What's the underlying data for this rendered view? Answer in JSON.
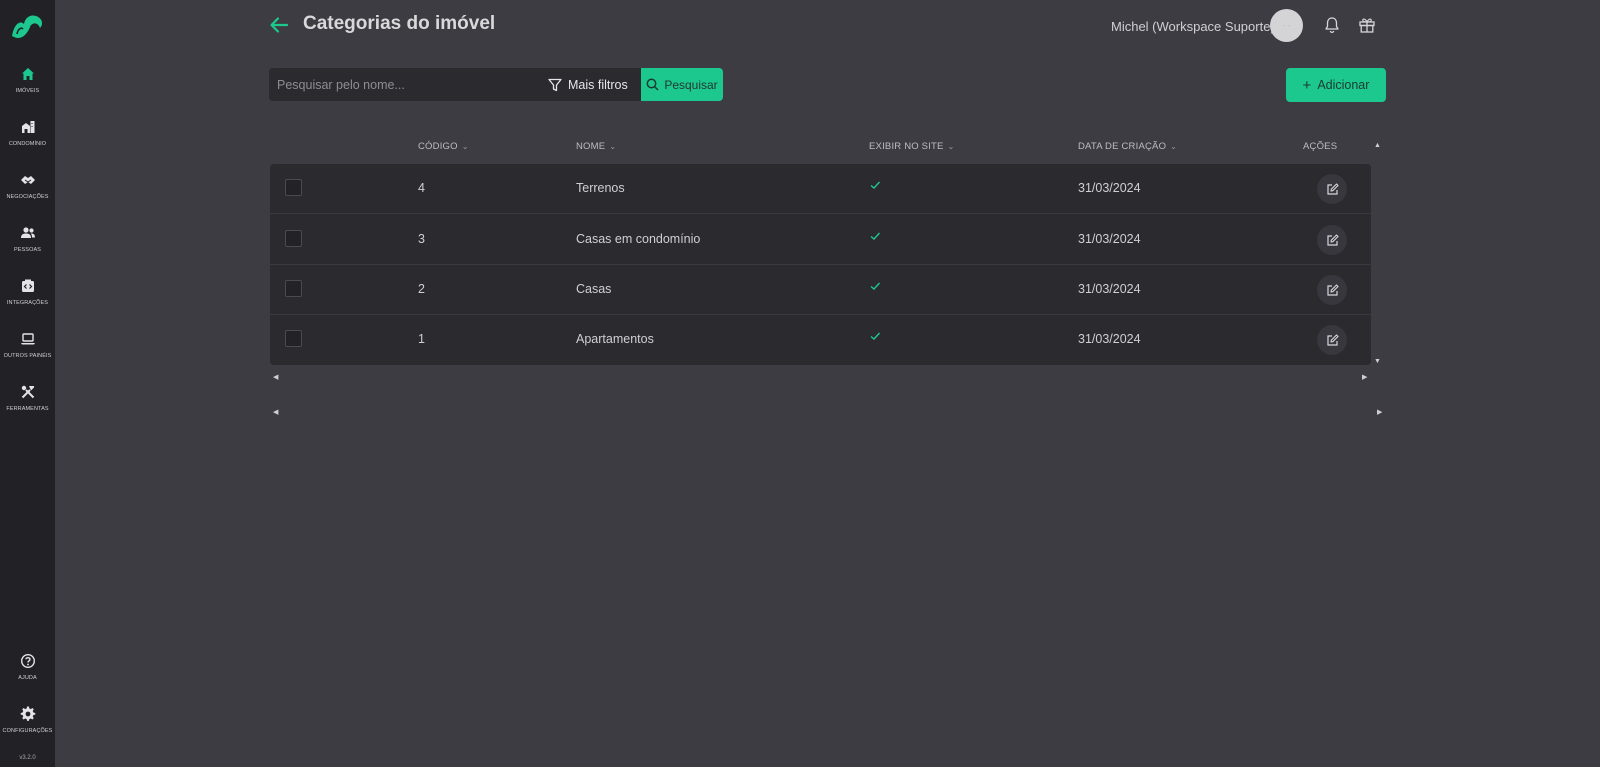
{
  "sidebar": {
    "items": [
      {
        "label": "IMÓVEIS",
        "icon": "home-icon"
      },
      {
        "label": "CONDOMÍNIO",
        "icon": "building-icon"
      },
      {
        "label": "NEGOCIAÇÕES",
        "icon": "handshake-icon"
      },
      {
        "label": "PESSOAS",
        "icon": "people-icon"
      },
      {
        "label": "INTEGRAÇÕES",
        "icon": "integration-icon"
      },
      {
        "label": "OUTROS PAINÉIS",
        "icon": "laptop-icon"
      },
      {
        "label": "FERRAMENTAS",
        "icon": "tools-icon"
      }
    ],
    "help_label": "AJUDA",
    "settings_label": "CONFIGURAÇÕES",
    "version": "v3.2.0"
  },
  "header": {
    "title": "Categorias do imóvel",
    "user": "Michel (Workspace Suporte)",
    "avatar_text": "- -"
  },
  "toolbar": {
    "search_placeholder": "Pesquisar pelo nome...",
    "filters_label": "Mais filtros",
    "search_label": "Pesquisar",
    "add_label": "Adicionar"
  },
  "table": {
    "columns": {
      "code": "CÓDIGO",
      "name": "NOME",
      "show_on_site": "EXIBIR NO SITE",
      "created": "DATA DE CRIAÇÃO",
      "actions": "AÇÕES"
    },
    "rows": [
      {
        "code": "4",
        "name": "Terrenos",
        "show_on_site": true,
        "created": "31/03/2024"
      },
      {
        "code": "3",
        "name": "Casas em condomínio",
        "show_on_site": true,
        "created": "31/03/2024"
      },
      {
        "code": "2",
        "name": "Casas",
        "show_on_site": true,
        "created": "31/03/2024"
      },
      {
        "code": "1",
        "name": "Apartamentos",
        "show_on_site": true,
        "created": "31/03/2024"
      }
    ]
  },
  "colors": {
    "accent": "#1dc88e",
    "sidebar_bg": "#222226",
    "page_bg": "#3d3c42",
    "table_bg": "#2b2a2f"
  }
}
